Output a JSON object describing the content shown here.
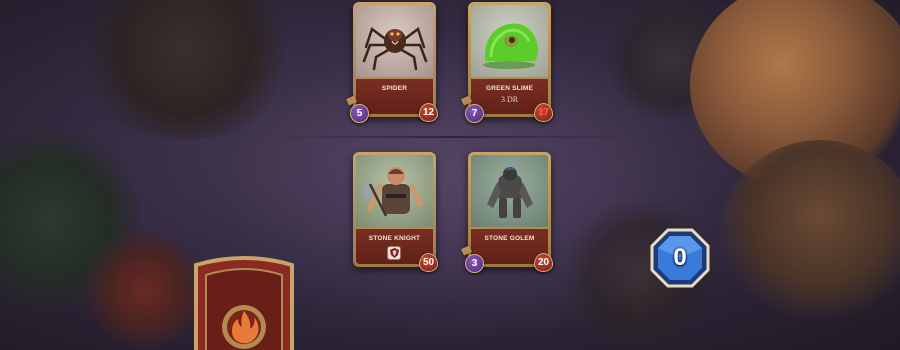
{
  "board": {
    "enemy_row": [
      {
        "name": "SPIDER",
        "subtitle": "",
        "attack": "5",
        "health": "12",
        "health_damaged": false,
        "icon": "spider-art"
      },
      {
        "name": "GREEN SLIME",
        "subtitle": "3 DR",
        "attack": "7",
        "health": "17",
        "health_damaged": true,
        "icon": "slime-art"
      }
    ],
    "player_row": [
      {
        "name": "STONE KNIGHT",
        "subtitle": "",
        "attack": "",
        "health": "50",
        "health_damaged": false,
        "icon": "knight-art",
        "badge_icon": "shield-icon"
      },
      {
        "name": "STONE GOLEM",
        "subtitle": "",
        "attack": "3",
        "health": "20",
        "health_damaged": false,
        "icon": "golem-art"
      }
    ]
  },
  "mana": {
    "value": "0",
    "color": "#3a7ad8"
  },
  "deck": {
    "icon": "fire-icon"
  },
  "colors": {
    "card_frame": "#c9a46a",
    "name_band": "#7a2e22",
    "attack_orb": "#6a3a9a",
    "health_orb": "#a8321e"
  }
}
